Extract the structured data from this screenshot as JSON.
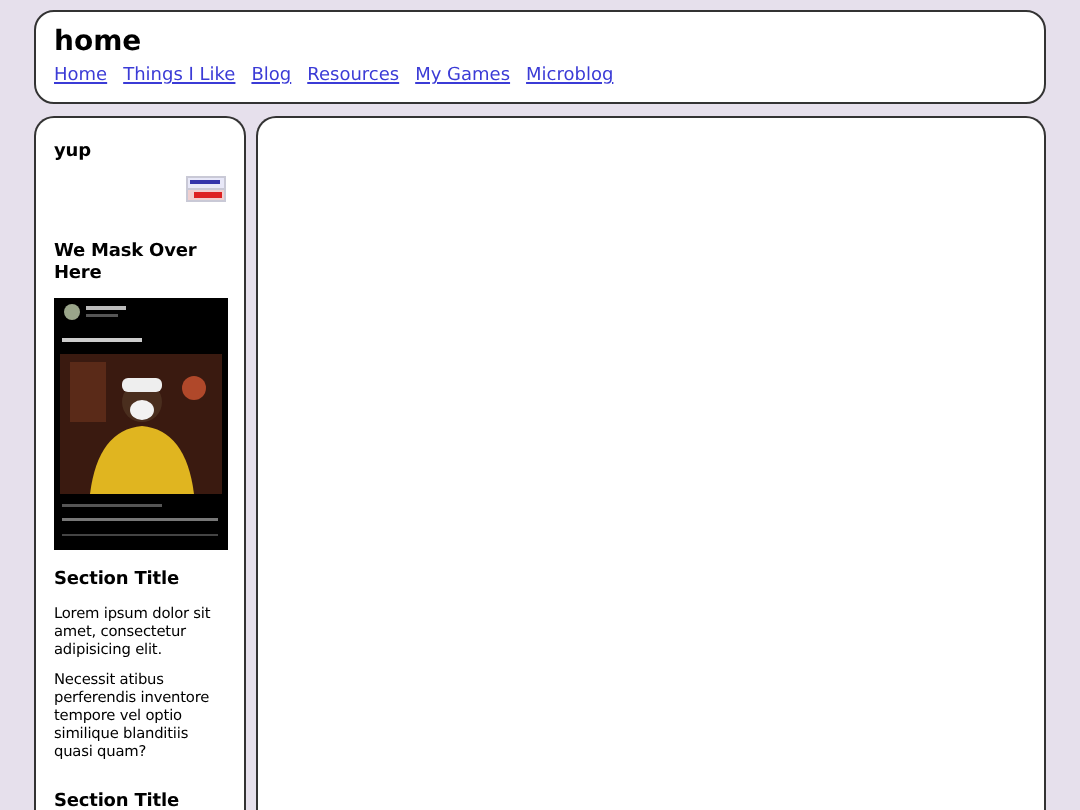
{
  "header": {
    "title": "home",
    "nav": [
      {
        "label": "Home"
      },
      {
        "label": "Things I Like"
      },
      {
        "label": "Blog"
      },
      {
        "label": "Resources"
      },
      {
        "label": "My Games"
      },
      {
        "label": "Microblog"
      }
    ]
  },
  "sidebar": {
    "sections": [
      {
        "kind": "banner",
        "title": "yup"
      },
      {
        "kind": "picture",
        "title": "We Mask Over Here"
      },
      {
        "kind": "text",
        "title": "Section Title",
        "paragraphs": [
          "Lorem ipsum dolor sit amet, consectetur adipisicing elit.",
          "Necessit atibus perferendis inventore tempore vel optio similique blanditiis quasi quam?"
        ]
      },
      {
        "kind": "text",
        "title": "Section Title"
      }
    ]
  }
}
